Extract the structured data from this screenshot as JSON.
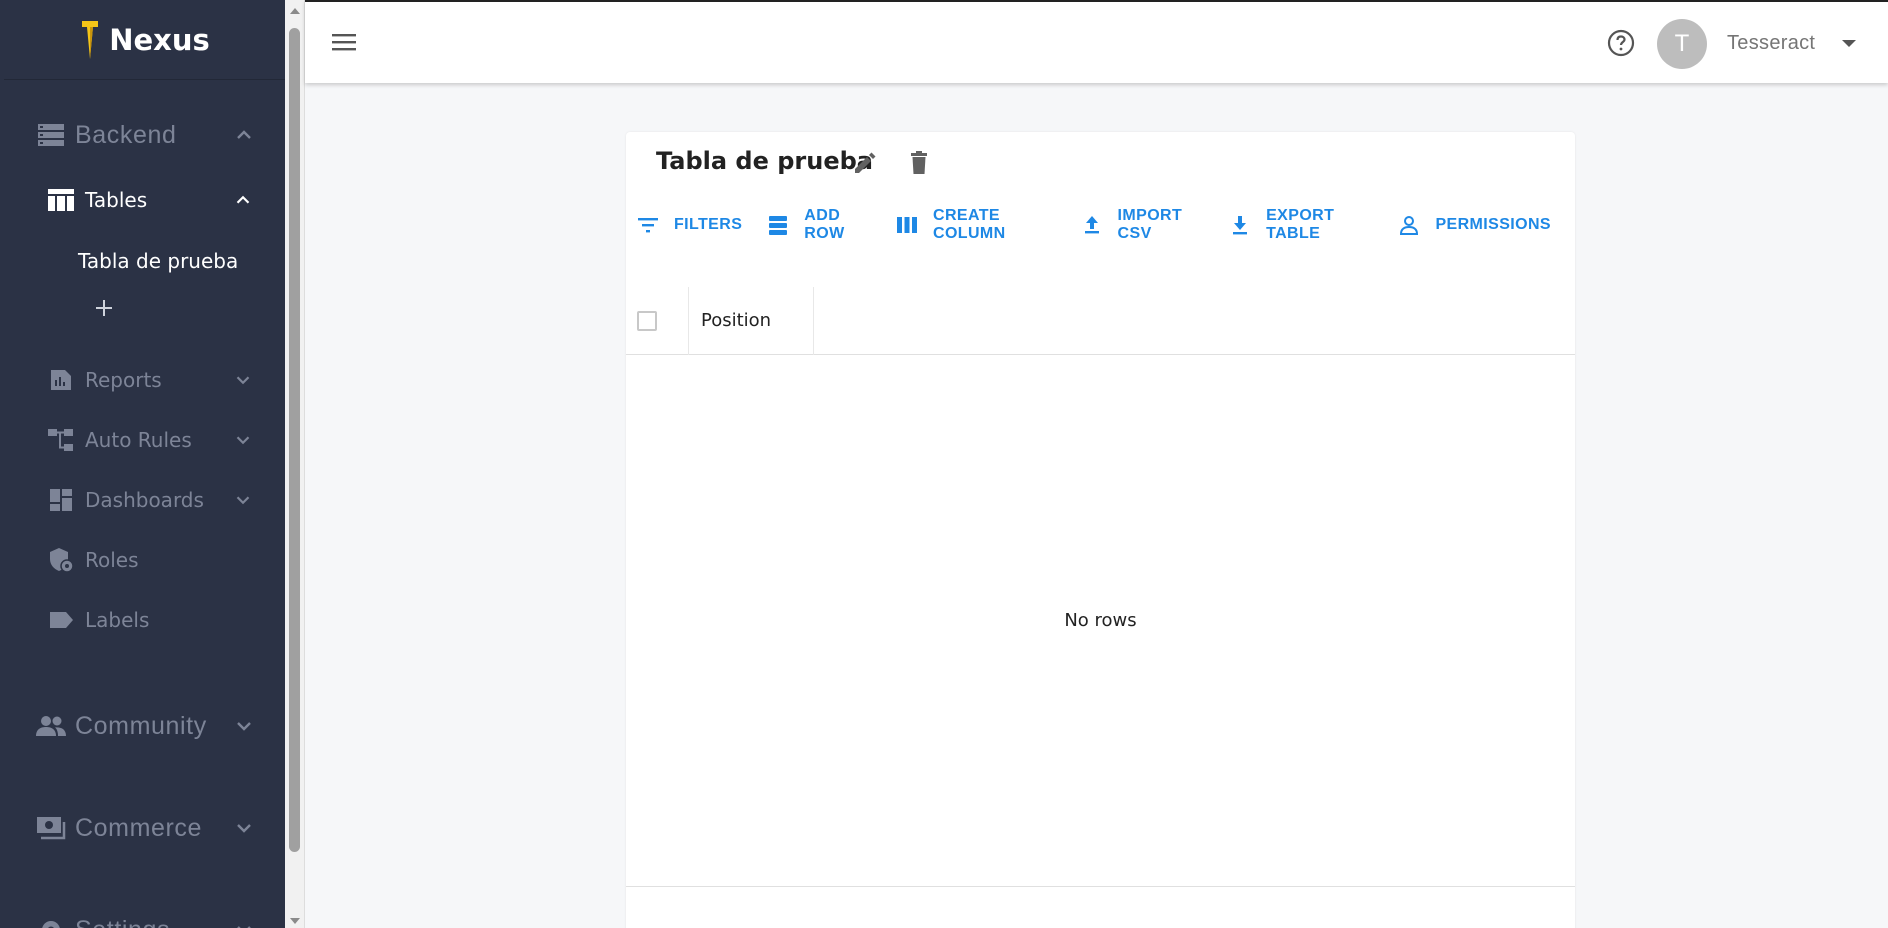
{
  "brand": {
    "name": "Nexus"
  },
  "sidebar": {
    "sections": [
      {
        "label": "Backend",
        "icon": "storage-icon",
        "expanded": true
      },
      {
        "label": "Community",
        "icon": "people-icon",
        "expanded": false
      },
      {
        "label": "Commerce",
        "icon": "cash-icon",
        "expanded": false
      },
      {
        "label": "Settings",
        "icon": "gear-icon",
        "expanded": false
      }
    ],
    "items": [
      {
        "label": "Tables",
        "icon": "table-icon",
        "active": true
      },
      {
        "label": "Reports",
        "icon": "report-icon"
      },
      {
        "label": "Auto Rules",
        "icon": "flow-icon"
      },
      {
        "label": "Dashboards",
        "icon": "dashboard-icon"
      },
      {
        "label": "Roles",
        "icon": "shield-icon"
      },
      {
        "label": "Labels",
        "icon": "label-icon"
      }
    ],
    "tables": [
      {
        "label": "Tabla de prueba"
      }
    ]
  },
  "topbar": {
    "user": {
      "initial": "T",
      "name": "Tesseract"
    }
  },
  "table": {
    "title": "Tabla de prueba",
    "toolbar": {
      "filters": "FILTERS",
      "add_row": "ADD ROW",
      "create_column": "CREATE COLUMN",
      "import_csv": "IMPORT CSV",
      "export_table": "EXPORT TABLE",
      "permissions": "PERMISSIONS"
    },
    "columns": [
      "Position"
    ],
    "empty_text": "No rows"
  },
  "colors": {
    "sidebar_bg": "#2b3245",
    "accent": "#1e88e5",
    "muted": "#7d8497",
    "brand_logo": "#f5c518"
  }
}
